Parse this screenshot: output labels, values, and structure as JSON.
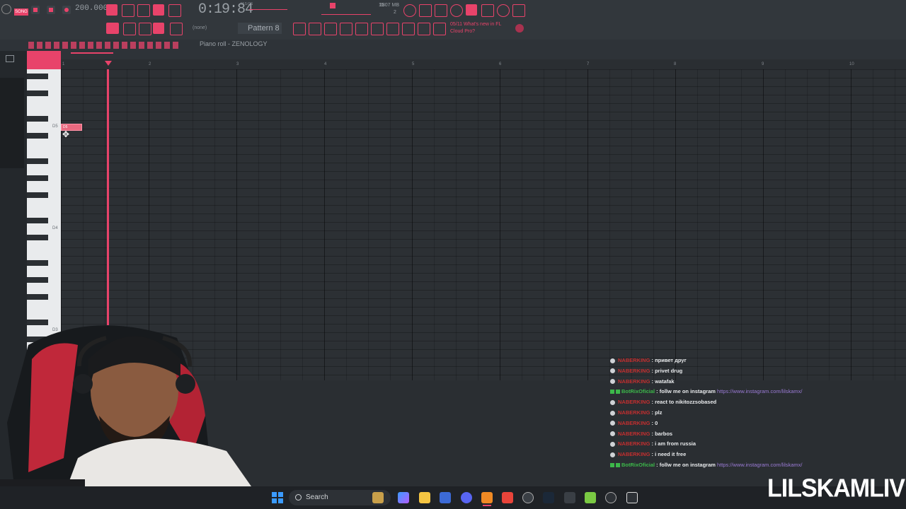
{
  "toolbar": {
    "mode_label": "SONG",
    "tempo": "200.000",
    "time": "0:19:84",
    "time_unit": "M:S:CS",
    "cpu_value": "15",
    "memory": "1807 MB",
    "voices": "2",
    "pattern": "Pattern 8",
    "channel_none": "(none)",
    "hint_line1": "05/11  What's new in FL",
    "hint_line2": "Cloud Pro?"
  },
  "piano_roll": {
    "title": "Piano roll - ZENOLOGY",
    "ruler_numbers": [
      "1",
      "2",
      "3",
      "4",
      "5",
      "6",
      "7",
      "8",
      "9",
      "10"
    ],
    "key_labels": [
      "D5",
      "D4",
      "D3"
    ],
    "note_label": "D5"
  },
  "chat": {
    "messages": [
      {
        "user": "NABERKING",
        "text": "привет друг",
        "bot": false
      },
      {
        "user": "NABERKING",
        "text": "privet drug",
        "bot": false
      },
      {
        "user": "NABERKING",
        "text": "watafak",
        "bot": false
      },
      {
        "user": "BotRixOficial",
        "text": "follw me on instagram",
        "link": "https://www.instagram.com/lilskamx/",
        "bot": true
      },
      {
        "user": "NABERKING",
        "text": "react to nikitozzsobased",
        "bot": false
      },
      {
        "user": "NABERKING",
        "text": "plz",
        "bot": false
      },
      {
        "user": "NABERKING",
        "text": "0",
        "bot": false
      },
      {
        "user": "NABERKING",
        "text": "barbos",
        "bot": false
      },
      {
        "user": "NABERKING",
        "text": "i am from russia",
        "bot": false
      },
      {
        "user": "NABERKING",
        "text": "i need it free",
        "bot": false
      },
      {
        "user": "BotRixOficial",
        "text": "follw me on instagram",
        "link": "https://www.instagram.com/lilskamx/",
        "bot": true
      }
    ]
  },
  "taskbar": {
    "search_label": "Search"
  },
  "overlay": {
    "brand": "LILSKAMLIVE"
  },
  "colors": {
    "accent": "#e8436a",
    "chat_user": "#c32f2f",
    "bot_user": "#3cb84a",
    "link": "#9b7bd6"
  }
}
